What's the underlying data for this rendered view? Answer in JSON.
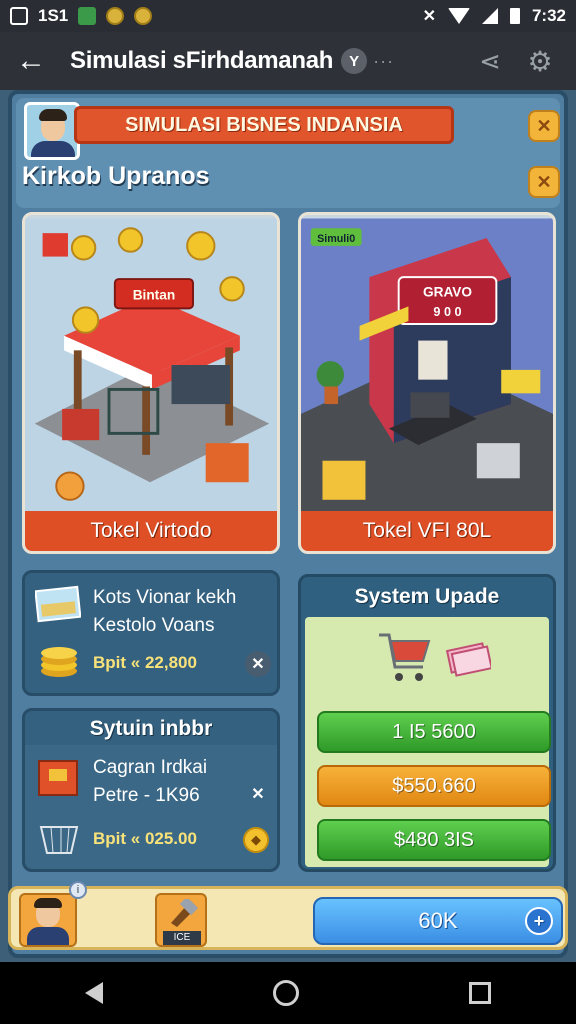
{
  "status_bar": {
    "left_text": "1S1",
    "time": "7:32"
  },
  "app_bar": {
    "title": "Simulasi sFirhdamanah",
    "badge": "Y",
    "dots": "···"
  },
  "header": {
    "banner": "SIMULASI BISNES INDANSIA",
    "subtitle": "Kirkob Upranos"
  },
  "shops": [
    {
      "label": "Tokel Virtodo",
      "sign": "Bintan"
    },
    {
      "label": "Tokel VFI 80L",
      "sign_top": "GRAVO",
      "sign_bottom": "9 0 0",
      "badge": "Simuli0"
    }
  ],
  "panel_left_top": {
    "line1": "Kots Vionar kekh",
    "line2": "Kestolo Voans",
    "price": "Bpit « 22,800"
  },
  "panel_left_bottom": {
    "title": "Sytuin inbbr",
    "line1": "Cagran Irdkai",
    "line2": "Petre - 1K96",
    "price": "Bpit « 025.00"
  },
  "upgrade": {
    "title": "System Upade",
    "buttons": [
      {
        "label": "1 I5 5600",
        "color": "green"
      },
      {
        "label": "$550.660",
        "color": "orange"
      },
      {
        "label": "$480 3IS",
        "color": "green"
      }
    ]
  },
  "bottom_bar": {
    "tool_label": "ICE",
    "balance": "60K"
  },
  "colors": {
    "accent_orange": "#de4f26",
    "panel_blue": "#34617f",
    "upgrade_bg": "#d6eab0"
  }
}
